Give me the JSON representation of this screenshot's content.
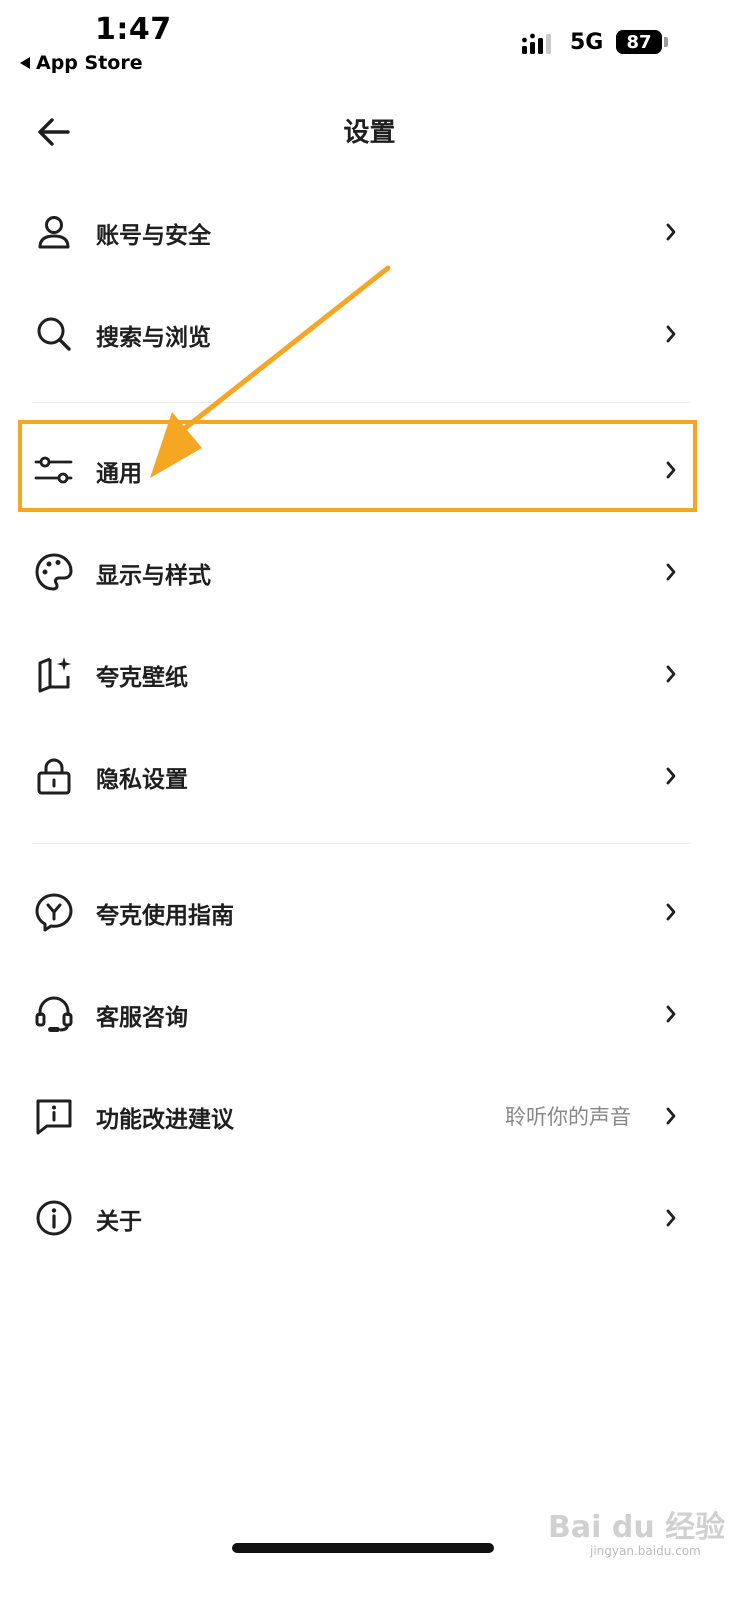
{
  "status_bar": {
    "time": "1:47",
    "back_app": "App Store",
    "network": "5G",
    "battery": "87"
  },
  "header": {
    "title": "设置",
    "back_icon": "arrow-left-icon"
  },
  "groups": [
    [
      {
        "label": "账号与安全",
        "icon": "user-icon",
        "value": ""
      },
      {
        "label": "搜索与浏览",
        "icon": "search-icon",
        "value": ""
      }
    ],
    [
      {
        "label": "通用",
        "icon": "sliders-icon",
        "value": ""
      },
      {
        "label": "显示与样式",
        "icon": "palette-icon",
        "value": ""
      },
      {
        "label": "夸克壁纸",
        "icon": "wallpaper-icon",
        "value": ""
      },
      {
        "label": "隐私设置",
        "icon": "lock-icon",
        "value": ""
      }
    ],
    [
      {
        "label": "夸克使用指南",
        "icon": "guide-icon",
        "value": ""
      },
      {
        "label": "客服咨询",
        "icon": "headset-icon",
        "value": ""
      },
      {
        "label": "功能改进建议",
        "icon": "feedback-icon",
        "value": "聆听你的声音"
      },
      {
        "label": "关于",
        "icon": "info-icon",
        "value": ""
      }
    ]
  ],
  "annotation": {
    "highlight_color": "#f5a623"
  },
  "watermark": {
    "brand": "Bai du 经验",
    "url": "jingyan.baidu.com"
  }
}
